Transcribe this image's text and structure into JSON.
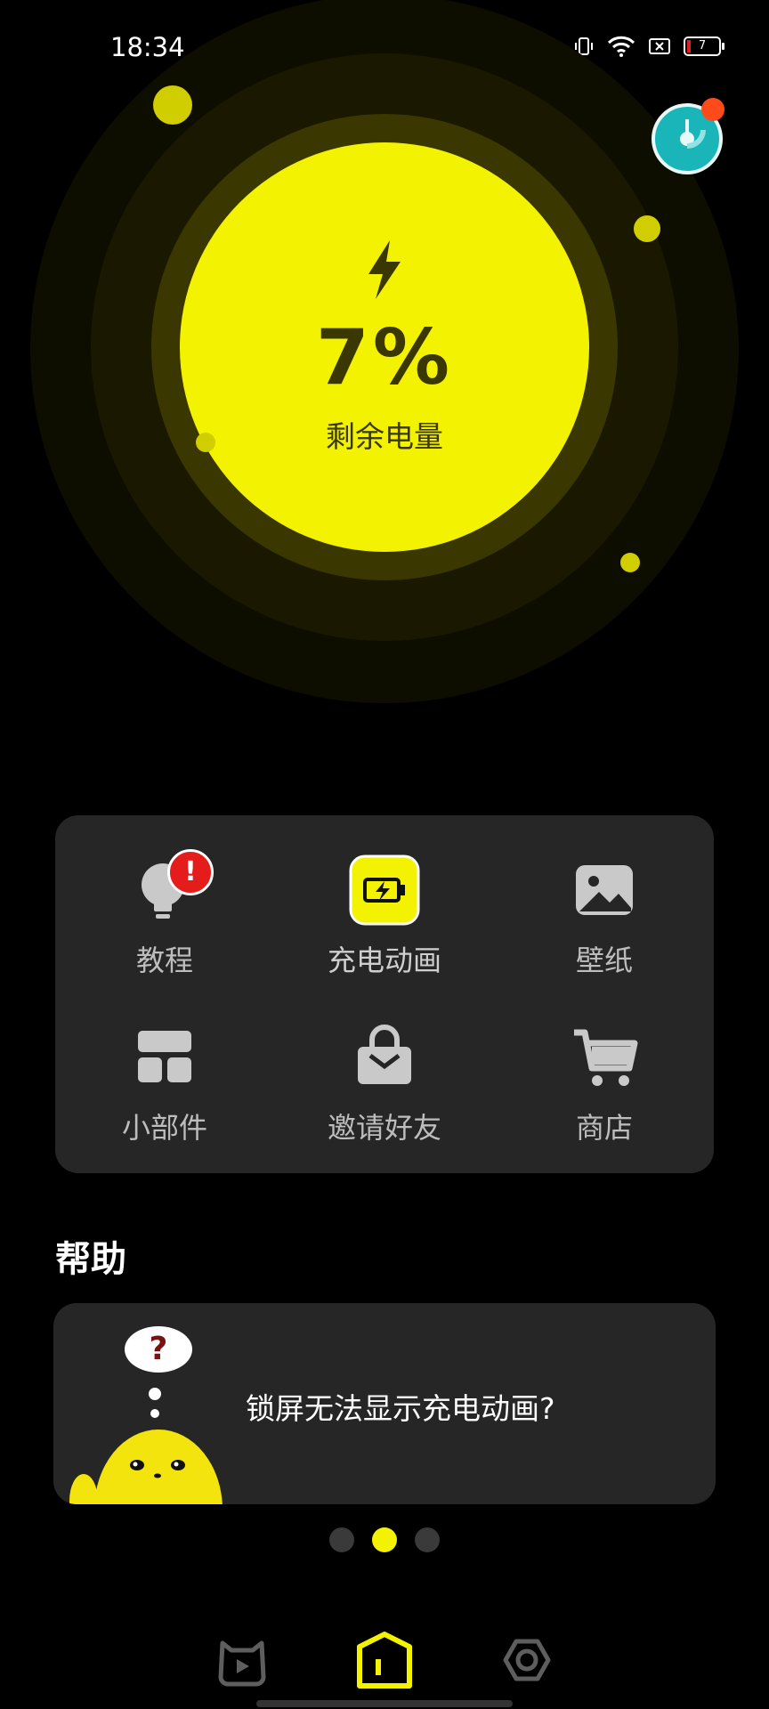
{
  "status_bar": {
    "time": "18:34",
    "battery_level": "7",
    "icons": [
      "vibrate-icon",
      "wifi-icon",
      "sim-icon",
      "battery-icon"
    ]
  },
  "hero": {
    "percent": "7%",
    "caption": "剩余电量",
    "icon": "lightning-bolt-icon"
  },
  "features": [
    {
      "label": "教程",
      "icon": "lightbulb-icon",
      "badge": "!"
    },
    {
      "label": "充电动画",
      "icon": "charging-animation-icon"
    },
    {
      "label": "壁纸",
      "icon": "image-icon"
    },
    {
      "label": "小部件",
      "icon": "widgets-icon"
    },
    {
      "label": "邀请好友",
      "icon": "gift-bag-icon"
    },
    {
      "label": "商店",
      "icon": "cart-icon"
    }
  ],
  "help": {
    "title": "帮助",
    "question": "锁屏无法显示充电动画?",
    "bubble": "?"
  },
  "pager": {
    "count": 3,
    "active": 1
  },
  "bottom_nav": [
    "pet-icon",
    "home-icon",
    "settings-icon"
  ],
  "colors": {
    "accent": "#f3f200",
    "panel": "#262626",
    "badge": "#e51c1c",
    "speed": "#1ab5b8"
  }
}
